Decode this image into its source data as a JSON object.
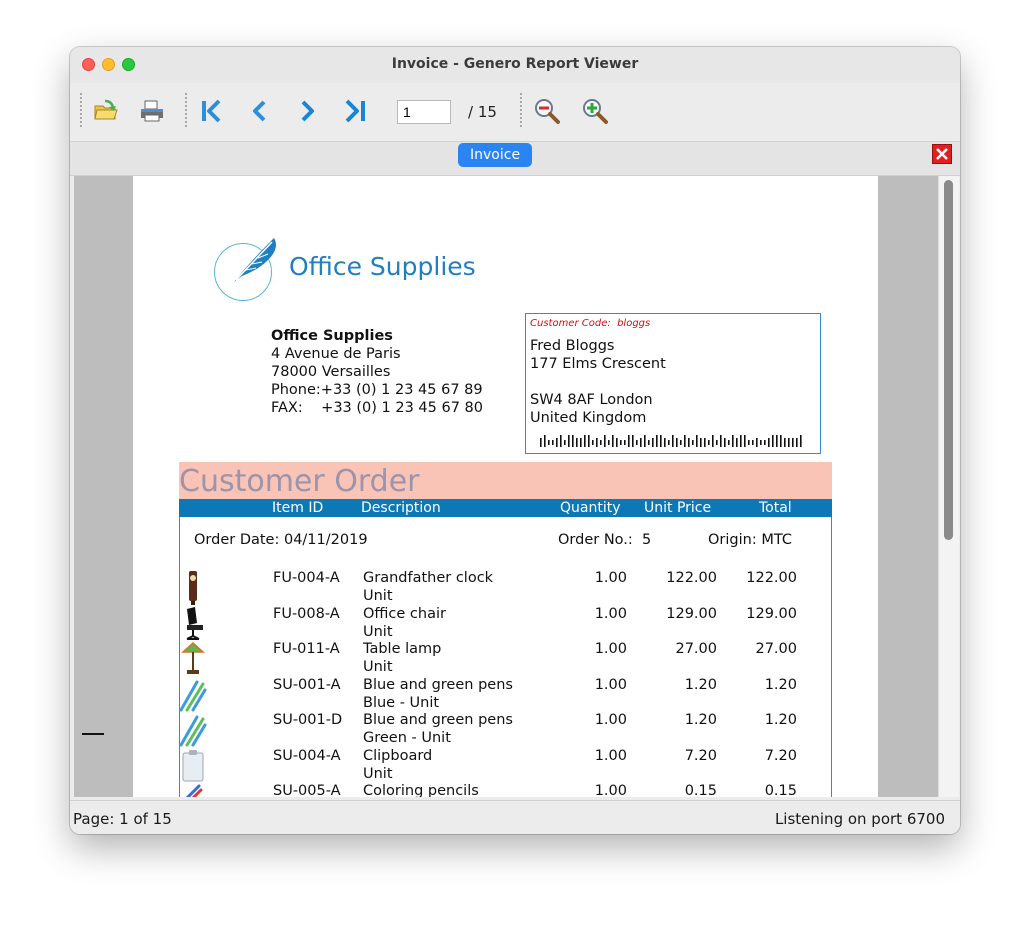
{
  "window": {
    "title": "Invoice - Genero Report Viewer"
  },
  "toolbar": {
    "page_input": "1",
    "page_total": "/ 15",
    "buttons": [
      "open-icon",
      "print-icon",
      "first-page-icon",
      "previous-page-icon",
      "next-page-icon",
      "last-page-icon",
      "zoom-out-icon",
      "zoom-in-icon"
    ]
  },
  "tab": {
    "label": "Invoice"
  },
  "document": {
    "logo_text": "Office Supplies",
    "sender": {
      "name": "Office Supplies",
      "street": "4 Avenue de Paris",
      "city": "78000 Versailles",
      "phone": "Phone:+33 (0) 1 23 45 67 89",
      "fax": "FAX:    +33 (0) 1 23 45 67 80"
    },
    "customer": {
      "code": "Customer Code:  bloggs",
      "name": "Fred Bloggs",
      "street": "177 Elms Crescent",
      "postcode_city": "SW4 8AF London",
      "country": "United Kingdom"
    },
    "order_title": "Customer Order",
    "columns": {
      "item_id": "Item ID",
      "description": "Description",
      "quantity": "Quantity",
      "unit_price": "Unit Price",
      "total": "Total"
    },
    "order_date": "Order Date: 04/11/2019",
    "order_no": "Order No.:  5",
    "origin": "Origin: MTC",
    "items": [
      {
        "id": "FU-004-A",
        "desc": "Grandfather clock",
        "desc2": "Unit",
        "qty": "1.00",
        "price": "122.00",
        "total": "122.00",
        "thumb": "clock-icon"
      },
      {
        "id": "FU-008-A",
        "desc": "Office chair",
        "desc2": "Unit",
        "qty": "1.00",
        "price": "129.00",
        "total": "129.00",
        "thumb": "chair-icon"
      },
      {
        "id": "FU-011-A",
        "desc": "Table lamp",
        "desc2": "Unit",
        "qty": "1.00",
        "price": "27.00",
        "total": "27.00",
        "thumb": "lamp-icon"
      },
      {
        "id": "SU-001-A",
        "desc": "Blue and green pens",
        "desc2": "Blue - Unit",
        "qty": "1.00",
        "price": "1.20",
        "total": "1.20",
        "thumb": "pens-icon"
      },
      {
        "id": "SU-001-D",
        "desc": "Blue and green pens",
        "desc2": "Green - Unit",
        "qty": "1.00",
        "price": "1.20",
        "total": "1.20",
        "thumb": "pens-icon"
      },
      {
        "id": "SU-004-A",
        "desc": "Clipboard",
        "desc2": "Unit",
        "qty": "1.00",
        "price": "7.20",
        "total": "7.20",
        "thumb": "clipboard-icon"
      },
      {
        "id": "SU-005-A",
        "desc": "Coloring pencils",
        "desc2": "",
        "qty": "1.00",
        "price": "0.15",
        "total": "0.15",
        "thumb": "pencil-icon"
      }
    ]
  },
  "status": {
    "left": "Page: 1 of 15",
    "right": "Listening on port 6700"
  }
}
